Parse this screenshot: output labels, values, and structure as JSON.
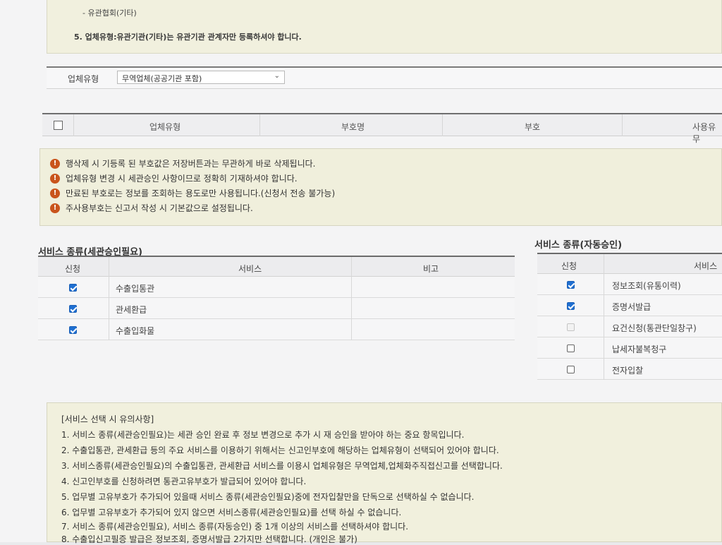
{
  "top_notice": {
    "line1": "- 유관협회(기타)",
    "line2": "5. 업체유형:유관기관(기타)는 유관기관 관계자만 등록하셔야 합니다."
  },
  "company_type": {
    "label": "업체유형",
    "selected": "무역업체(공공기관 포함)"
  },
  "symbol_table": {
    "columns": [
      "업체유형",
      "부호명",
      "부호",
      "사용유무"
    ]
  },
  "warnings": [
    "행삭제 시 기등록 된 부호값은 저장버튼과는 무관하게 바로 삭제됩니다.",
    "업체유형 변경 시 세관승인 사항이므로 정확히 기재하셔야 합니다.",
    "만료된 부호로는 정보를 조회하는 용도로만 사용됩니다.(신청서 전송 불가능)",
    "주사용부호는 신고서 작성 시 기본값으로 설정됩니다."
  ],
  "services_customs": {
    "title": "서비스 종류(세관승인필요)",
    "columns": [
      "신청",
      "서비스",
      "비고"
    ],
    "rows": [
      {
        "service": "수출입통관",
        "checked": true
      },
      {
        "service": "관세환급",
        "checked": true
      },
      {
        "service": "수출입화물",
        "checked": true
      }
    ]
  },
  "services_auto": {
    "title": "서비스 종류(자동승인)",
    "columns": [
      "신청",
      "서비스"
    ],
    "rows": [
      {
        "service": "정보조회(유통이력)",
        "state": "checked"
      },
      {
        "service": "증명서발급",
        "state": "checked"
      },
      {
        "service": "요건신청(통관단일창구)",
        "state": "disabled"
      },
      {
        "service": "납세자불복청구",
        "state": "unchecked"
      },
      {
        "service": "전자입찰",
        "state": "unchecked"
      }
    ]
  },
  "notes": {
    "title": "[서비스 선택 시 유의사항]",
    "items": [
      "1. 서비스 종류(세관승인필요)는 세관 승인 완료 후 정보 변경으로 추가 시 재 승인을 받아야 하는 중요 항목입니다.",
      "2. 수출입통관, 관세환급 등의 주요 서비스를 이용하기 위해서는 신고인부호에 해당하는 업체유형이 선택되어 있어야 합니다.",
      "3. 서비스종류(세관승인필요)의 수출입통관, 관세환급 서비스를 이용시 업체유형은 무역업체,업체화주직접신고를 선택합니다.",
      "4. 신고인부호를 신청하려면 통관고유부호가 발급되어 있어야 합니다.",
      "5. 업무별 고유부호가 추가되어 있을때 서비스 종류(세관승인필요)중에 전자입찰만을 단독으로 선택하실 수 없습니다.",
      "6. 업무별 고유부호가 추가되어 있지 않으면 서비스종류(세관승인필요)를 선택 하실 수 없습니다.",
      "7. 서비스 종류(세관승인필요), 서비스 종류(자동승인) 중 1개 이상의 서비스를 선택하셔야 합니다.",
      "8. 수출입신고필증 발급은 정보조회, 증명서발급 2가지만 선택합니다. (개인은 불가)"
    ]
  },
  "colors": {
    "notice_bg": "#f1f0de",
    "warn_icon": "#c9541c",
    "check_on": "#1f6fd1"
  }
}
